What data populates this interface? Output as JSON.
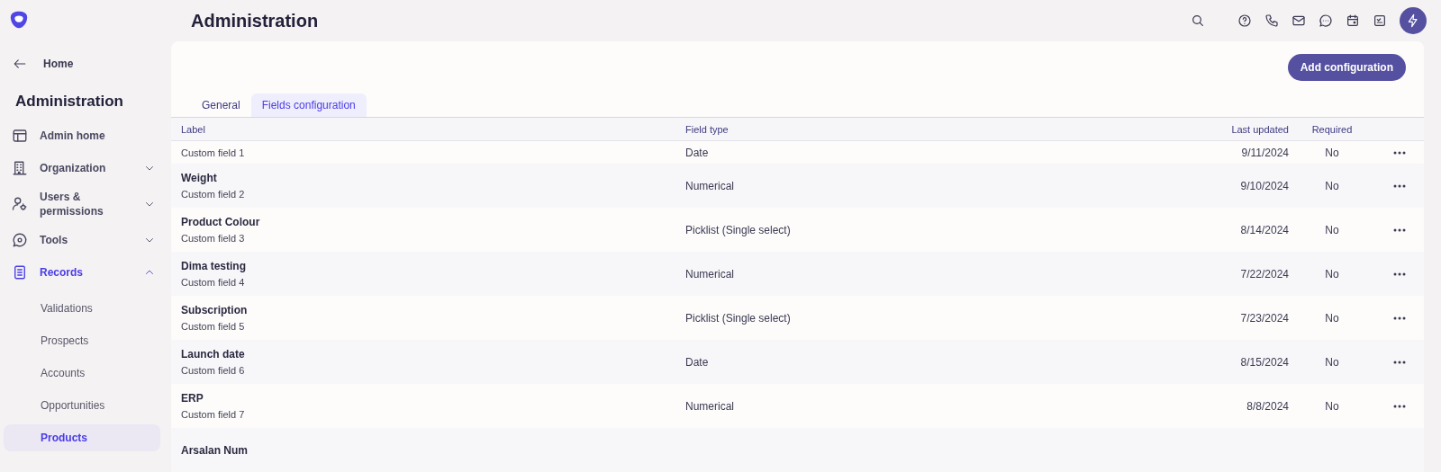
{
  "sidebar": {
    "back": {
      "label": "Home"
    },
    "heading": "Administration",
    "items": [
      {
        "label": "Admin home",
        "selected": false
      },
      {
        "label": "Organization",
        "selected": false,
        "expanded": false
      },
      {
        "label": "Users & permissions",
        "selected": false,
        "expanded": false
      },
      {
        "label": "Tools",
        "selected": false,
        "expanded": false
      },
      {
        "label": "Records",
        "selected": true,
        "expanded": true,
        "children": [
          {
            "label": "Validations",
            "selected": false
          },
          {
            "label": "Prospects",
            "selected": false
          },
          {
            "label": "Accounts",
            "selected": false
          },
          {
            "label": "Opportunities",
            "selected": false
          },
          {
            "label": "Products",
            "selected": true
          }
        ]
      }
    ]
  },
  "header": {
    "title": "Administration"
  },
  "content": {
    "primary_button": "Add configuration",
    "tabs": [
      {
        "label": "General",
        "selected": false
      },
      {
        "label": "Fields configuration",
        "selected": true
      }
    ],
    "table": {
      "columns": [
        {
          "label": "Label"
        },
        {
          "label": "Field type"
        },
        {
          "label": "Last updated"
        },
        {
          "label": "Required"
        }
      ],
      "rows": [
        {
          "sublabel": "Custom field 1",
          "field_type": "Date",
          "last_updated": "9/11/2024",
          "required": "No"
        },
        {
          "label": "Weight",
          "sublabel": "Custom field 2",
          "field_type": "Numerical",
          "last_updated": "9/10/2024",
          "required": "No"
        },
        {
          "label": "Product Colour",
          "sublabel": "Custom field 3",
          "field_type": "Picklist (Single select)",
          "last_updated": "8/14/2024",
          "required": "No"
        },
        {
          "label": "Dima testing",
          "sublabel": "Custom field 4",
          "field_type": "Numerical",
          "last_updated": "7/22/2024",
          "required": "No"
        },
        {
          "label": "Subscription",
          "sublabel": "Custom field 5",
          "field_type": "Picklist (Single select)",
          "last_updated": "7/23/2024",
          "required": "No"
        },
        {
          "label": "Launch date",
          "sublabel": "Custom field 6",
          "field_type": "Date",
          "last_updated": "8/15/2024",
          "required": "No"
        },
        {
          "label": "ERP",
          "sublabel": "Custom field 7",
          "field_type": "Numerical",
          "last_updated": "8/8/2024",
          "required": "No"
        },
        {
          "label": "Arsalan Num"
        }
      ]
    }
  }
}
